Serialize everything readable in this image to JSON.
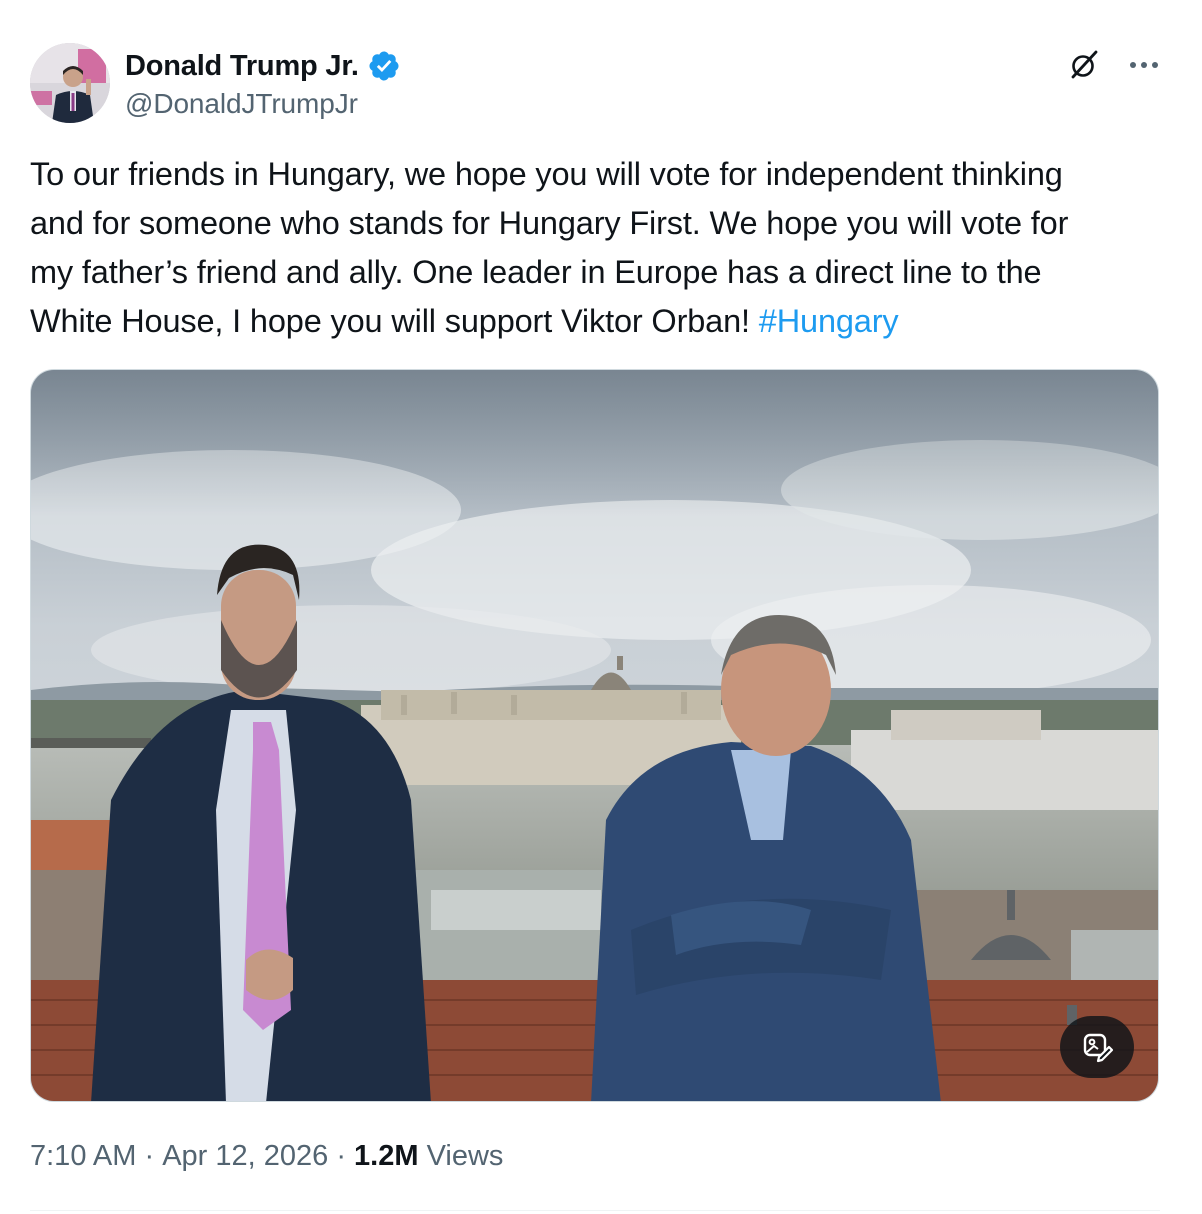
{
  "author": {
    "display_name": "Donald Trump Jr.",
    "handle": "@DonaldJTrumpJr",
    "verified": true,
    "avatar_icon": "profile-photo"
  },
  "tweet": {
    "text": "To our friends in Hungary, we hope you will vote for independent thinking\nand for someone who stands for Hungary First. We hope you will vote for\nmy father’s friend and ally. One leader in Europe has a direct line to the\nWhite House, I hope you will support Viktor Orban! ",
    "hashtag": "#Hungary"
  },
  "media": {
    "type": "photo",
    "edit_icon": "image-edit-icon"
  },
  "meta": {
    "time": "7:10 AM",
    "separator": " · ",
    "date": "Apr 12, 2026",
    "views_count": "1.2M",
    "views_label": " Views"
  },
  "icons": {
    "grok": "grok-icon",
    "more": "more-icon",
    "verified": "verified-badge-icon"
  },
  "colors": {
    "text": "#0f1419",
    "secondary": "#536471",
    "link": "#1d9bf0",
    "verified": "#1d9bf0"
  }
}
